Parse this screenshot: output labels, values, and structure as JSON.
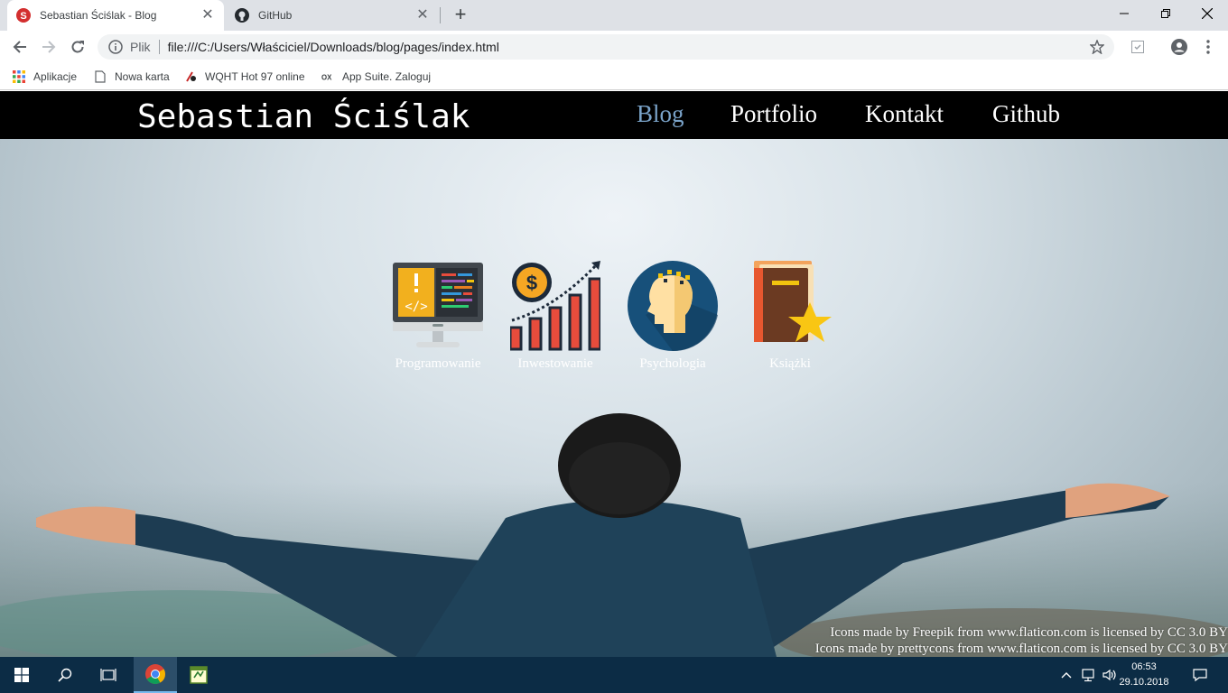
{
  "browser": {
    "tabs": [
      {
        "title": "Sebastian Ściślak - Blog",
        "active": true,
        "favicon": "s-logo-icon"
      },
      {
        "title": "GitHub",
        "active": false,
        "favicon": "github-icon"
      }
    ],
    "omnibox": {
      "scheme_label": "Plik",
      "url": "file:///C:/Users/Właściciel/Downloads/blog/pages/index.html"
    },
    "bookmarks": [
      {
        "label": "Aplikacje",
        "icon": "apps-grid-icon"
      },
      {
        "label": "Nowa karta",
        "icon": "page-icon"
      },
      {
        "label": "WQHT Hot 97 online",
        "icon": "radio-icon"
      },
      {
        "label": "App Suite. Zaloguj",
        "icon": "ox-icon"
      }
    ]
  },
  "site": {
    "title": "Sebastian Ściślak",
    "nav": [
      "Blog",
      "Portfolio",
      "Kontakt",
      "Github"
    ],
    "active_nav": "Blog",
    "categories": [
      {
        "label": "Programowanie",
        "icon": "code-monitor-icon"
      },
      {
        "label": "Inwestowanie",
        "icon": "growth-chart-icon"
      },
      {
        "label": "Psychologia",
        "icon": "head-mind-icon"
      },
      {
        "label": "Książki",
        "icon": "book-star-icon"
      }
    ],
    "credits": [
      "Icons made by Freepik from www.flaticon.com is licensed by CC 3.0 BY",
      "Icons made by prettycons from www.flaticon.com is licensed by CC 3.0 BY"
    ],
    "colors": {
      "header_bg": "#000000",
      "nav_active": "#7aa3c9",
      "nav_text": "#ffffff"
    }
  },
  "taskbar": {
    "time": "06:53",
    "date": "29.10.2018",
    "pinned": [
      "windows-start-icon",
      "search-icon",
      "task-view-icon",
      "chrome-icon",
      "notepad-icon"
    ]
  }
}
